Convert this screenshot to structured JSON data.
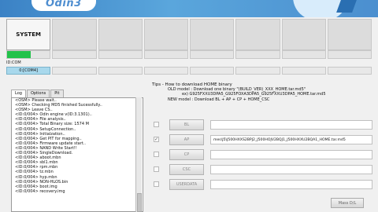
{
  "app": {
    "logo_text": "Odin3"
  },
  "ports": {
    "system_label": "SYSTEM",
    "progress_fraction": 0.55
  },
  "id_com": {
    "label": "ID:COM",
    "active_port": "0:[COM4]"
  },
  "log": {
    "tabs": [
      "Log",
      "Options",
      "Pit"
    ],
    "lines": [
      "<OSM> Please wait..",
      "<OSM> Checking MD5 finished Sucessfully..",
      "<OSM> Leave CS..",
      "<ID:0/004> Odin engine v(ID:3.1301)..",
      "<ID:0/004> File analysis..",
      "<ID:0/004> Total Binary size: 1574 M",
      "<ID:0/004> SetupConnection..",
      "<ID:0/004> Initialzation..",
      "<ID:0/004> Get PIT for mapping..",
      "<ID:0/004> Firmware update start..",
      "<ID:0/004> NAND Write Start!!",
      "<ID:0/004> SingleDownload.",
      "<ID:0/004> aboot.mbn",
      "<ID:0/004> sbl1.mbn",
      "<ID:0/004> rpm.mbn",
      "<ID:0/004> tz.mbn",
      "<ID:0/004> hyp.mbn",
      "<ID:0/004> NON-HLOS.bin",
      "<ID:0/004> boot.img",
      "<ID:0/004> recovery.img"
    ]
  },
  "tips": {
    "title": "Tips - How to download HOME binary",
    "old_model_1": "OLD model : Download one binary   \"(BUILD_VER)_XXX_HOME.tar.md5\"",
    "old_model_2": "ex) G925FXXU3DPA5_G925FOXA3DPA5_G925FXXU3DPA5_HOME.tar.md5",
    "new_model": "NEW model : Download BL + AP + CP + HOME_CSC"
  },
  "files": [
    {
      "label": "BL",
      "checked": false,
      "path": ""
    },
    {
      "label": "AP",
      "checked": true,
      "path": "mes\\J5\\J500HXXS2BPJ2_J500HOJV2BQJ1_J500HXXU2BQA1_HOME.tar.md5"
    },
    {
      "label": "CP",
      "checked": false,
      "path": ""
    },
    {
      "label": "CSC",
      "checked": false,
      "path": ""
    },
    {
      "label": "USERDATA",
      "checked": false,
      "path": ""
    }
  ],
  "actions": {
    "mass_dl_label": "Mass D/L"
  }
}
